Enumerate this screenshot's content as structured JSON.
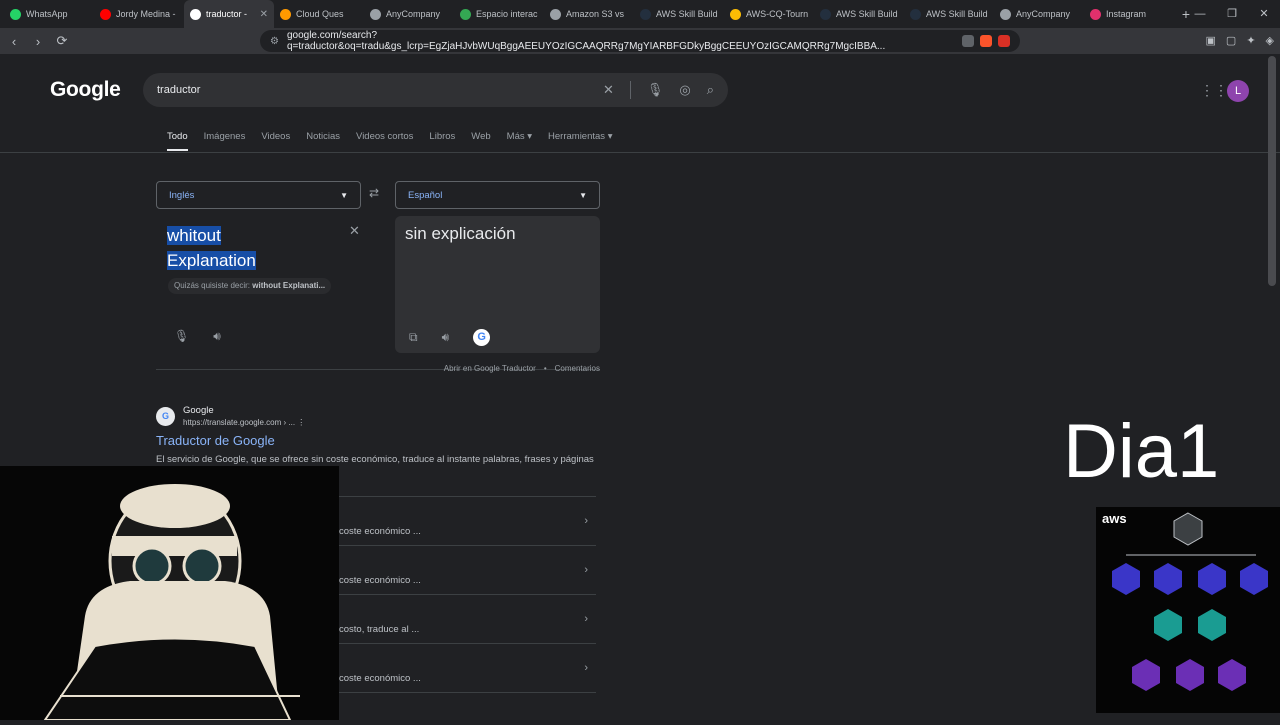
{
  "tabs": [
    {
      "label": "WhatsApp",
      "color": "#25d366",
      "active": false
    },
    {
      "label": "Jordy Medina -",
      "color": "#ff0000",
      "active": false
    },
    {
      "label": "traductor -",
      "color": "#ffffff",
      "active": true
    },
    {
      "label": "Cloud Ques",
      "color": "#ff9900",
      "active": false
    },
    {
      "label": "AnyCompany",
      "color": "#9aa0a6",
      "active": false
    },
    {
      "label": "Espacio interac",
      "color": "#34a853",
      "active": false
    },
    {
      "label": "Amazon S3 vs",
      "color": "#9aa0a6",
      "active": false
    },
    {
      "label": "AWS Skill Build",
      "color": "#232f3e",
      "active": false
    },
    {
      "label": "AWS-CQ-Tourn",
      "color": "#fbbc04",
      "active": false
    },
    {
      "label": "AWS Skill Build",
      "color": "#232f3e",
      "active": false
    },
    {
      "label": "AWS Skill Build",
      "color": "#232f3e",
      "active": false
    },
    {
      "label": "AnyCompany",
      "color": "#9aa0a6",
      "active": false
    },
    {
      "label": "Instagram",
      "color": "#e1306c",
      "active": false
    }
  ],
  "url": "google.com/search?q=traductor&oq=tradu&gs_lcrp=EgZjaHJvbWUqBggAEEUYOzIGCAAQRRg7MgYIARBFGDkyBggCEEUYOzIGCAMQRRg7MgcIBBA...",
  "search": {
    "logo": "Google",
    "query": "traductor"
  },
  "avatar_letter": "L",
  "filters": [
    "Todo",
    "Imágenes",
    "Videos",
    "Noticias",
    "Videos cortos",
    "Libros",
    "Web",
    "Más ▾",
    "Herramientas ▾"
  ],
  "translator": {
    "source_lang": "Inglés",
    "target_lang": "Español",
    "source_line1": "whitout",
    "source_line2": "Explanation",
    "suggest_prefix": "Quizás quisiste decir:",
    "suggest_value": "without Explanati...",
    "target_text": "sin explicación",
    "open_link": "Abrir en Google Traductor",
    "feedback_link": "Comentarios"
  },
  "result": {
    "site_name": "Google",
    "site_url": "https://translate.google.com › ...",
    "title": "Traductor de Google",
    "snippet": "El servicio de Google, que se ofrece sin coste económico, traduce al instante palabras, frases y páginas"
  },
  "sublinks": [
    "coste económico ...",
    "coste económico ...",
    "costo, traduce al ...",
    "coste económico ..."
  ],
  "overlay": {
    "dia_label": "Dia1",
    "aws_logo": "aws"
  }
}
